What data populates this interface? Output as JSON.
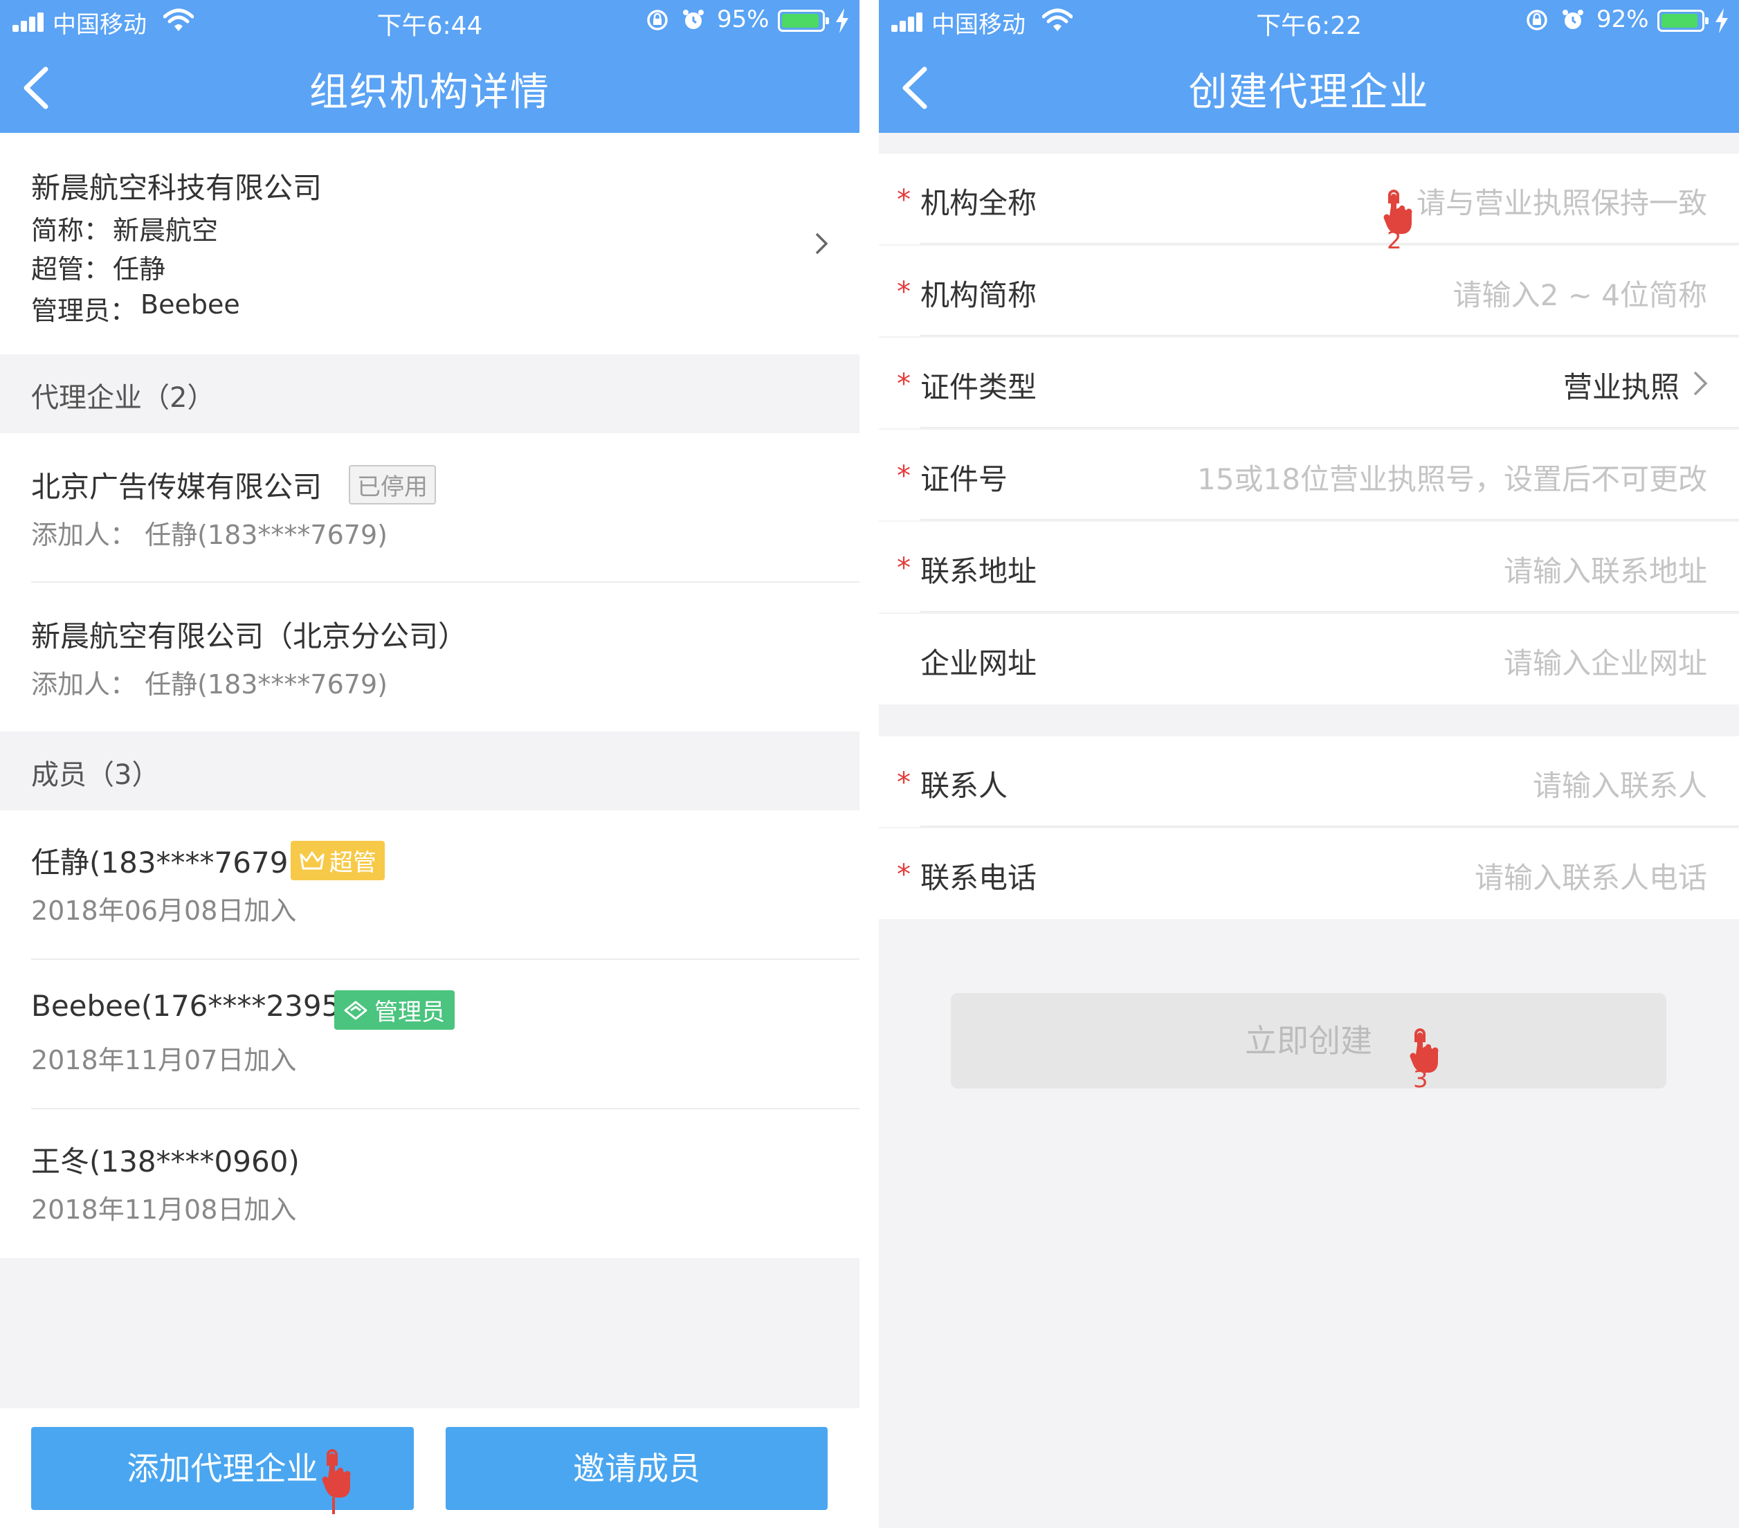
{
  "left": {
    "status": {
      "carrier": "中国移动",
      "time": "下午6:44",
      "battery": "95%",
      "battery_level": 0.95
    },
    "nav": {
      "title": "组织机构详情"
    },
    "org": {
      "name": "新晨航空科技有限公司",
      "short_label": "简称：",
      "short_value": "新晨航空",
      "super_label": "超管：",
      "super_value": "任静",
      "admin_label": "管理员：",
      "admin_value": "Beebee"
    },
    "agency_section": {
      "title": "代理企业（2）"
    },
    "agencies": [
      {
        "name": "北京广告传媒有限公司",
        "tag": "已停用",
        "added_by": "添加人： 任静(183****7679)"
      },
      {
        "name": "新晨航空有限公司（北京分公司）",
        "added_by": "添加人： 任静(183****7679)"
      }
    ],
    "member_section": {
      "title": "成员（3）"
    },
    "members": [
      {
        "name": "任静(183****7679)",
        "tag": "超管",
        "joined": "2018年06月08日加入"
      },
      {
        "name": "Beebee(176****2395)",
        "tag": "管理员",
        "joined": "2018年11月07日加入"
      },
      {
        "name": "王冬(138****0960)",
        "joined": "2018年11月08日加入"
      }
    ],
    "buttons": {
      "add_agency": "添加代理企业",
      "invite": "邀请成员"
    },
    "cursor_icon": "hand-pointer-icon",
    "colors": {
      "primary": "#5aa3f5",
      "button": "#4aa6f0",
      "super_tag": "#f7c948",
      "admin_tag": "#4ac47e"
    }
  },
  "right": {
    "status": {
      "carrier": "中国移动",
      "time": "下午6:22",
      "battery": "92%",
      "battery_level": 0.92
    },
    "nav": {
      "title": "创建代理企业"
    },
    "fields": [
      {
        "label": "机构全称",
        "required": true,
        "placeholder": "请与营业执照保持一致"
      },
      {
        "label": "机构简称",
        "required": true,
        "placeholder": "请输入2 ~ 4位简称"
      },
      {
        "label": "证件类型",
        "required": true,
        "value": "营业执照"
      },
      {
        "label": "证件号",
        "required": true,
        "placeholder": "15或18位营业执照号，设置后不可更改"
      },
      {
        "label": "联系地址",
        "required": true,
        "placeholder": "请输入联系地址"
      },
      {
        "label": "企业网址",
        "required": false,
        "placeholder": "请输入企业网址"
      }
    ],
    "contact_fields": [
      {
        "label": "联系人",
        "required": true,
        "placeholder": "请输入联系人"
      },
      {
        "label": "联系电话",
        "required": true,
        "placeholder": "请输入联系人电话"
      }
    ],
    "required_mark": "*",
    "submit_label": "立即创建",
    "step_labels": [
      "2",
      "3"
    ],
    "colors": {
      "required": "#e23b3b",
      "placeholder": "#c4c4c4",
      "submit_bg": "#e6e6e6",
      "step": "#e0443c"
    }
  }
}
